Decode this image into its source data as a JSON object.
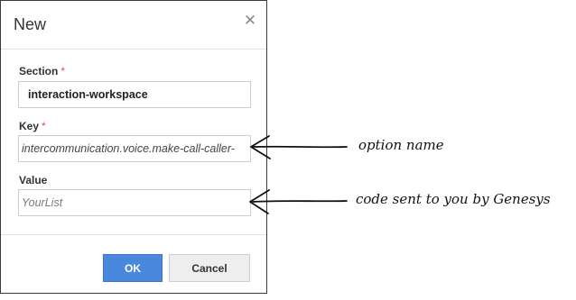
{
  "dialog": {
    "title": "New",
    "close_icon": "close-icon",
    "fields": {
      "section": {
        "label": "Section",
        "required_marker": "*",
        "value": "interaction-workspace"
      },
      "key": {
        "label": "Key",
        "required_marker": "*",
        "value": "intercommunication.voice.make-call-caller-"
      },
      "value": {
        "label": "Value",
        "placeholder": "YourList"
      }
    },
    "buttons": {
      "ok_label": "OK",
      "cancel_label": "Cancel"
    },
    "colors": {
      "ok_button": "#4a88de",
      "required_marker": "#d9534f",
      "border": "#3a3a3a"
    }
  },
  "annotations": {
    "key_note": "option name",
    "value_note": "code sent to you by Genesys"
  }
}
